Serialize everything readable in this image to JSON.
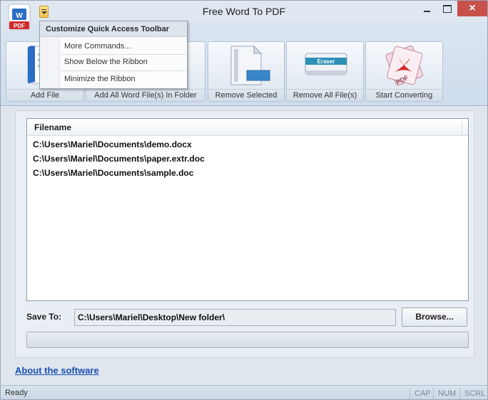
{
  "window": {
    "title": "Free Word To PDF",
    "close_glyph": "×"
  },
  "app_icon": {
    "badge": "PDF"
  },
  "qat_menu": {
    "header": "Customize Quick Access Toolbar",
    "items": [
      "More Commands...",
      "Show Below the Ribbon",
      "Minimize the Ribbon"
    ]
  },
  "ribbon": {
    "buttons": [
      {
        "label": "Add File",
        "icon": "word-file-icon"
      },
      {
        "label": "Add All Word File(s) In Folder",
        "icon": "folder-icon"
      },
      {
        "label": "Remove Selected",
        "icon": "document-remove-icon"
      },
      {
        "label": "Remove All File(s)",
        "icon": "eraser-icon",
        "icon_text": "Eraser"
      },
      {
        "label": "Start Converting",
        "icon": "pdf-icon",
        "icon_text": "PDF"
      }
    ]
  },
  "file_list": {
    "column": "Filename",
    "rows": [
      "C:\\Users\\Mariel\\Documents\\demo.docx",
      "C:\\Users\\Mariel\\Documents\\paper.extr.doc",
      "C:\\Users\\Mariel\\Documents\\sample.doc"
    ]
  },
  "save": {
    "label": "Save To:",
    "path": "C:\\Users\\Mariel\\Desktop\\New folder\\",
    "browse_label": "Browse..."
  },
  "progress": {
    "fraction": 0
  },
  "about_link": "About the software",
  "status": {
    "text": "Ready",
    "keys": [
      "CAP",
      "NUM",
      "SCRL"
    ]
  },
  "colors": {
    "accent_link": "#1a4fb0",
    "close_button": "#c7504b",
    "pdf_red": "#d02a2a",
    "word_blue": "#2b6cc4"
  }
}
